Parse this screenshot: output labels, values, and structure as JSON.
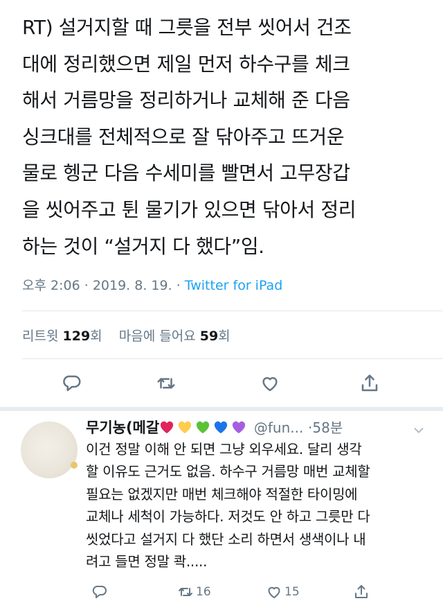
{
  "tweet": {
    "lines": [
      "RT) 설거지할 때 그릇을 전부 씻어서 건조",
      "대에 정리했으면 제일 먼저 하수구를 체크",
      "해서 거름망을 정리하거나 교체해 준 다음",
      "싱크대를 전체적으로 잘 닦아주고 뜨거운",
      "물로 헹군 다음 수세미를 빨면서 고무장갑",
      "을 씻어주고 튄 물기가 있으면 닦아서 정리",
      "하는 것이 “설거지 다 했다”임."
    ],
    "time": "오후 2:06",
    "separator": "·",
    "date": "2019. 8. 19.",
    "source": "Twitter for iPad"
  },
  "stats": {
    "retweets_label": "리트윗",
    "retweets_count": "129",
    "retweets_unit": "회",
    "likes_label": "마음에 들어요",
    "likes_count": "59",
    "likes_unit": "회"
  },
  "reply": {
    "name": "무기농(메갈",
    "hearts": [
      "#e0245e",
      "#ffcc4d",
      "#5bc236",
      "#1d74e8",
      "#a65ee0"
    ],
    "handle": "@fun...",
    "separator": "·",
    "time": "58분",
    "lines": [
      "이건 정말 이해 안 되면 그냥 외우세요. 달리 생각",
      "할 이유도 근거도 없음. 하수구 거름망 매번 교체할",
      "필요는 없겠지만 매번 체크해야 적절한 타이밍에",
      "교체나 세척이 가능하다. 저것도 안 하고 그릇만 다",
      "씻었다고 설거지 다 했단 소리 하면서 생색이나 내",
      "려고 들면 정말 콱....."
    ],
    "retweet_count": "16",
    "like_count": "15"
  },
  "icons": {
    "reply": "reply-icon",
    "retweet": "retweet-icon",
    "like": "heart-icon",
    "share": "share-icon",
    "more": "chevron-down-icon"
  },
  "colors": {
    "text": "#14171a",
    "muted": "#657786",
    "link": "#1da1f2",
    "divider": "#e1e8ed"
  }
}
